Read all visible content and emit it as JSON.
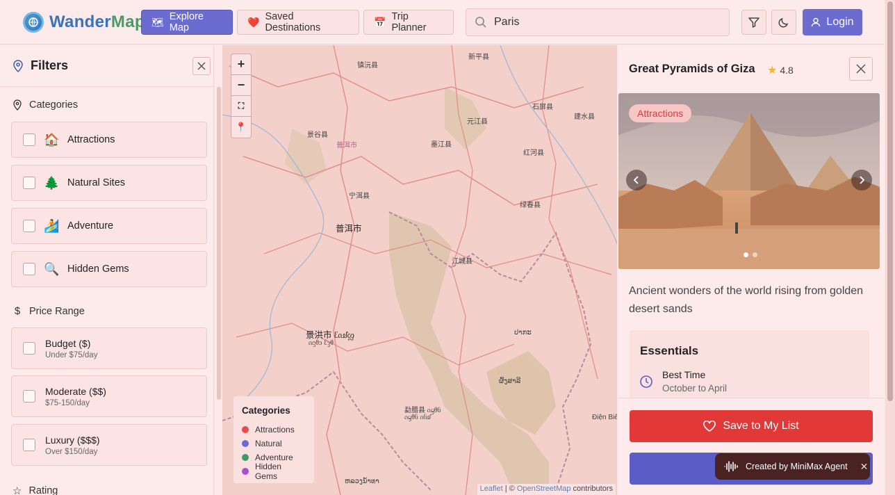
{
  "app": {
    "logo_part1": "Wander",
    "logo_part2": "Map"
  },
  "nav": {
    "explore_label": "Explore Map",
    "saved_label": "Saved Destinations",
    "trip_label": "Trip Planner",
    "login_label": "Login"
  },
  "search": {
    "value": "Paris"
  },
  "sidebar": {
    "title": "Filters",
    "categories_label": "Categories",
    "categories": [
      {
        "emoji": "🏠",
        "label": "Attractions"
      },
      {
        "emoji": "🌲",
        "label": "Natural Sites"
      },
      {
        "emoji": "🏄",
        "label": "Adventure"
      },
      {
        "emoji": "🔍",
        "label": "Hidden Gems"
      }
    ],
    "price_label": "Price Range",
    "prices": [
      {
        "title": "Budget ($)",
        "sub": "Under $75/day"
      },
      {
        "title": "Moderate ($$)",
        "sub": "$75-150/day"
      },
      {
        "title": "Luxury ($$$)",
        "sub": "Over $150/day"
      }
    ],
    "rating_label": "Rating"
  },
  "map": {
    "labels": [
      "镇沅县",
      "新平县",
      "石屏县",
      "元江县",
      "墨江县",
      "景谷县",
      "普洱市",
      "建水县",
      "红河县",
      "宁洱县",
      "绿春县",
      "普洱市",
      "江城县",
      "景洪市 ᦷᦵᦾᦜ",
      "ᦵᦋᦲᦱ ᦷᦡᦲ",
      "勐腊县 ᦵᦙᦲᦑ",
      "ᦵᦙᦲᦑ ᦵᦑᦾ",
      "ປາກະ",
      "ຜົ້ງສາລີ",
      "Điện Biên Phủ",
      "ຫລວງນ້ຳທາ"
    ],
    "legend": {
      "title": "Categories",
      "items": [
        {
          "label": "Attractions",
          "color": "#e84b4b"
        },
        {
          "label": "Natural",
          "color": "#6a6ad6"
        },
        {
          "label": "Adventure",
          "color": "#3f9a63"
        },
        {
          "label": "Hidden Gems",
          "color": "#a94fd0"
        }
      ]
    },
    "attribution_leaflet": "Leaflet",
    "attribution_sep": " | © ",
    "attribution_osm": "OpenStreetMap",
    "attribution_tail": " contributors"
  },
  "detail": {
    "title": "Great Pyramids of Giza",
    "rating": "4.8",
    "tag": "Attractions",
    "description": "Ancient wonders of the world rising from golden desert sands",
    "essentials_title": "Essentials",
    "best_time_label": "Best Time",
    "best_time_value": "October to April",
    "save_label": "Save to My List"
  },
  "toast": {
    "text": "Created by MiniMax Agent"
  },
  "colors": {
    "primary": "#6b6bd0",
    "danger": "#e23838",
    "background": "#fde8e8"
  }
}
